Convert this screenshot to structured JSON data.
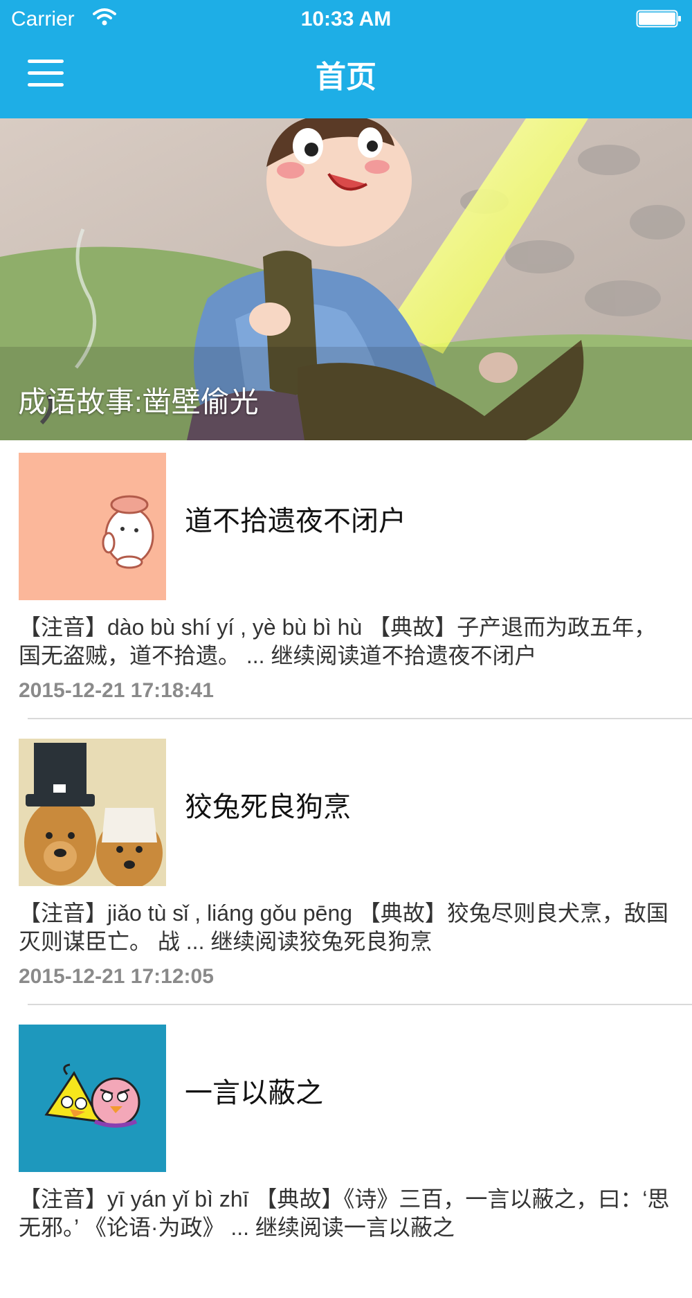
{
  "status_bar": {
    "carrier": "Carrier",
    "time": "10:33 AM"
  },
  "nav": {
    "title": "首页",
    "menu_icon": "hamburger-menu-icon"
  },
  "banner": {
    "caption": "成语故事:凿壁偷光"
  },
  "articles": [
    {
      "title": "道不拾遗夜不闭户",
      "summary": "【注音】dào bù shí yí , yè bù bì hù 【典故】子产退而为政五年，国无盗贼，道不拾遗。 ... 继续阅读道不拾遗夜不闭户",
      "date": "2015-12-21 17:18:41",
      "thumb_icon": "cartoon-bunny-thumbnail"
    },
    {
      "title": "狡兔死良狗烹",
      "summary": "【注音】jiǎo tù sǐ , liáng gǒu pēng 【典故】狡兔尽则良犬烹，敌国灭则谋臣亡。        战 ... 继续阅读狡兔死良狗烹",
      "date": "2015-12-21 17:12:05",
      "thumb_icon": "dogs-with-hats-thumbnail"
    },
    {
      "title": "一言以蔽之",
      "summary": "【注音】yī yán yǐ bì zhī 【典故】《诗》三百，一言以蔽之，曰：‘思无邪。’        《论语·为政》 ... 继续阅读一言以蔽之",
      "date": "",
      "thumb_icon": "angry-birds-thumbnail"
    }
  ],
  "colors": {
    "nav_background": "#1eaee6",
    "title_text": "#111111",
    "summary_text": "#333333",
    "date_text": "#8a8a8a",
    "divider": "#d9d9d9"
  }
}
